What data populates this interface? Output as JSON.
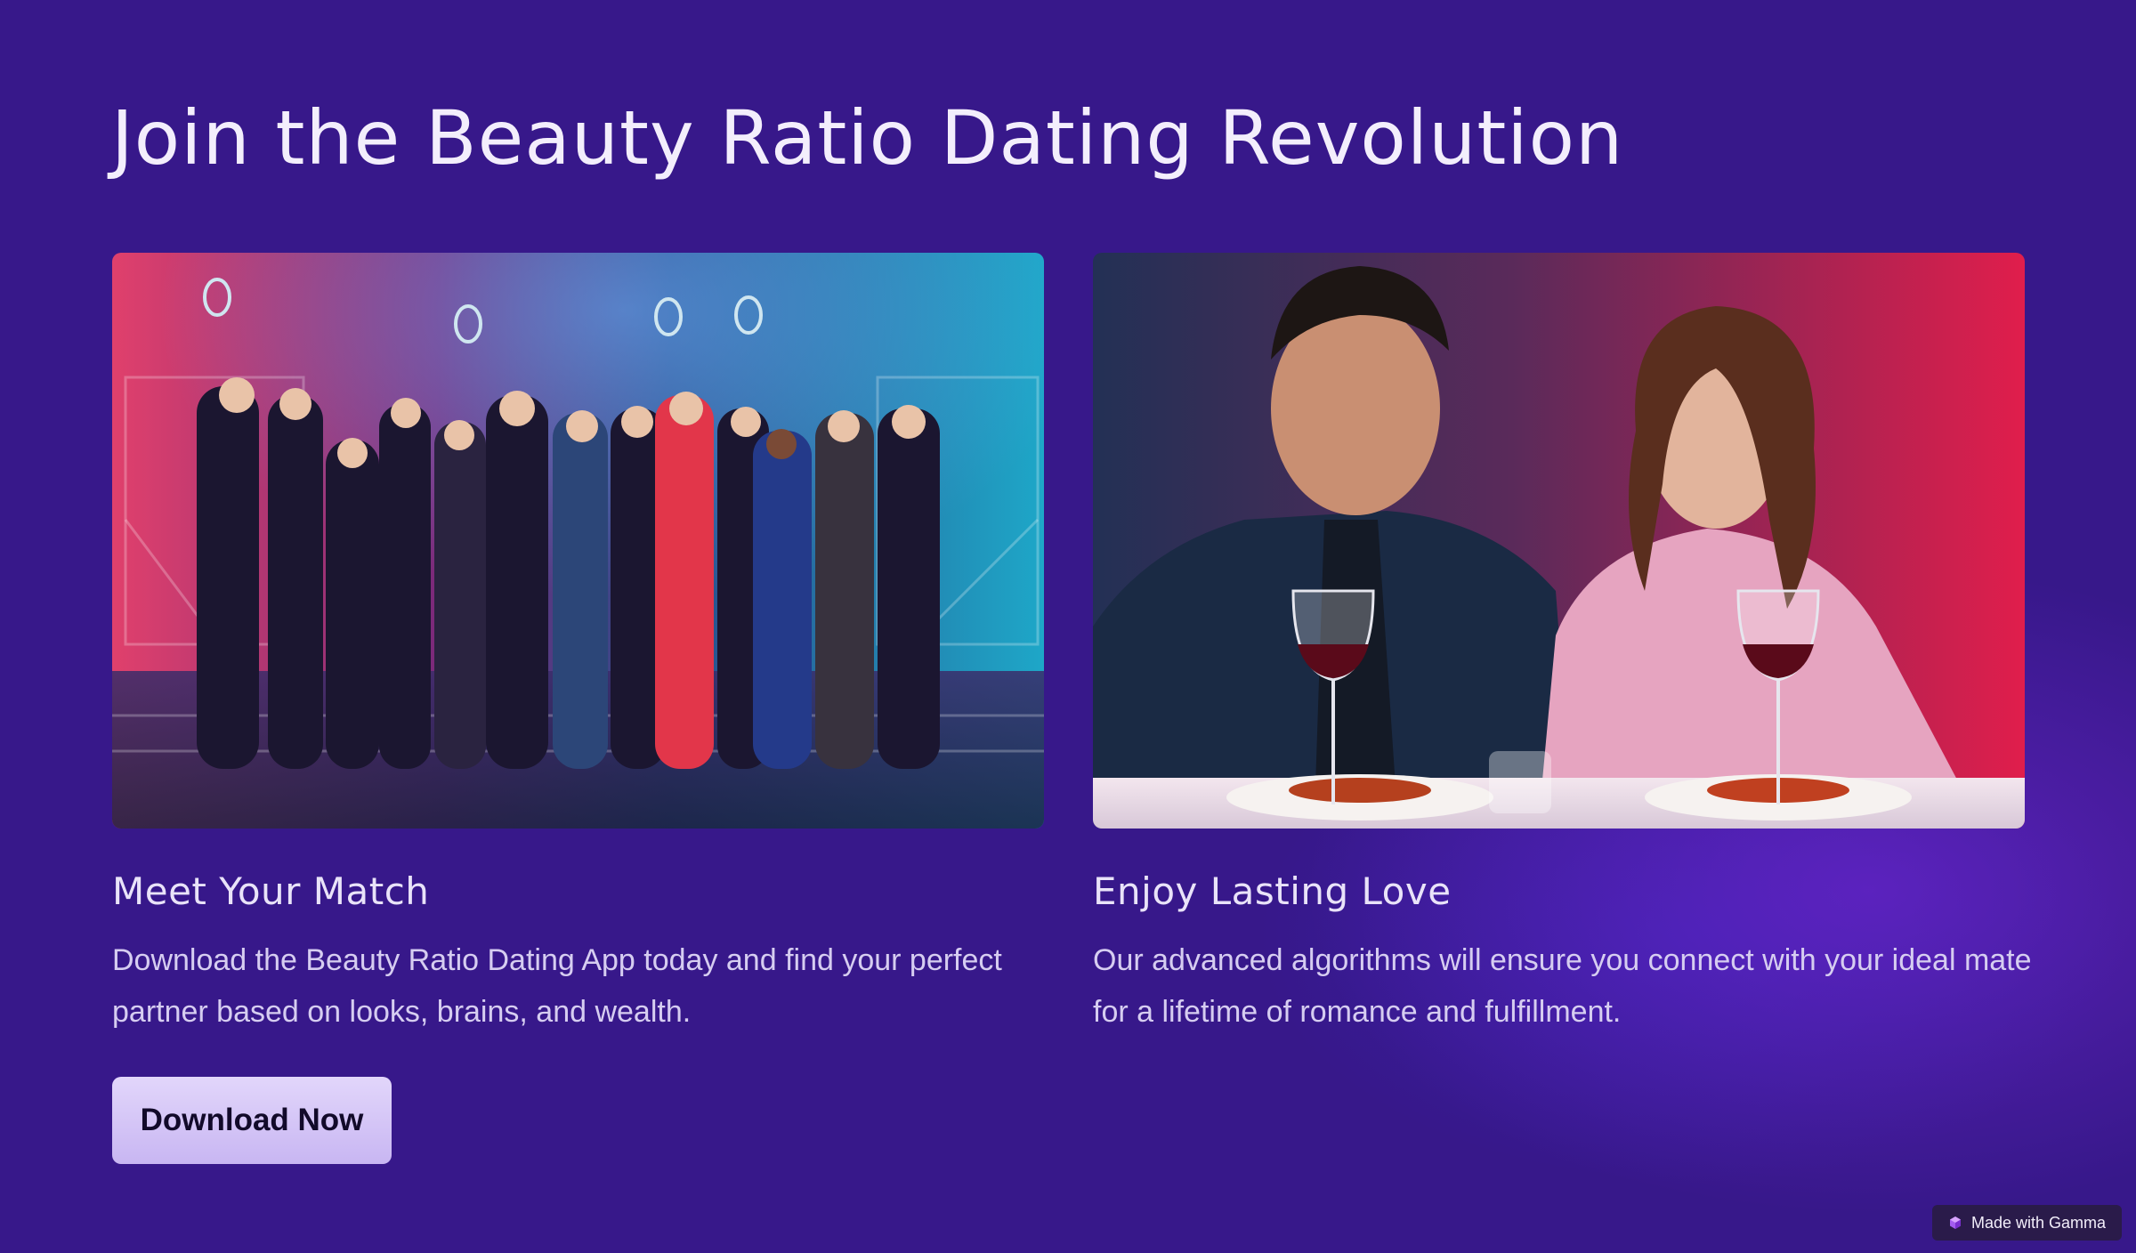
{
  "page": {
    "title": "Join the Beauty Ratio Dating Revolution"
  },
  "cards": [
    {
      "image_alt": "group-of-award-winners-photo",
      "title": "Meet Your Match",
      "description": "Download the Beauty Ratio Dating App today and find your perfect partner based on looks, brains, and wealth."
    },
    {
      "image_alt": "couple-dinner-date-photo",
      "title": "Enjoy Lasting Love",
      "description": "Our advanced algorithms will ensure you connect with your ideal mate for a lifetime of romance and fulfillment."
    }
  ],
  "cta": {
    "label": "Download Now"
  },
  "badge": {
    "label": "Made with Gamma",
    "icon": "gamma-logo-icon"
  },
  "colors": {
    "background": "#37188a",
    "button": "#d4c4f6",
    "text": "#f3eefc"
  }
}
